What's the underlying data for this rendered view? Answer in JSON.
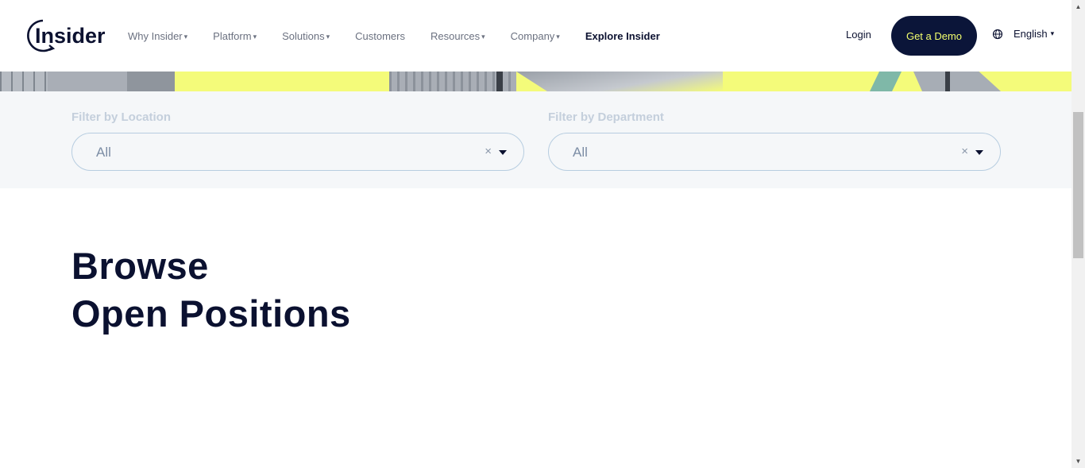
{
  "brand": {
    "logo_text": "Insider"
  },
  "nav": {
    "items": [
      {
        "label": "Why Insider",
        "has_dropdown": true
      },
      {
        "label": "Platform",
        "has_dropdown": true
      },
      {
        "label": "Solutions",
        "has_dropdown": true
      },
      {
        "label": "Customers",
        "has_dropdown": false
      },
      {
        "label": "Resources",
        "has_dropdown": true
      },
      {
        "label": "Company",
        "has_dropdown": true
      },
      {
        "label": "Explore Insider",
        "has_dropdown": false
      }
    ],
    "caret": "▾"
  },
  "header_actions": {
    "login_label": "Login",
    "demo_label": "Get a Demo",
    "language_label": "English",
    "language_caret": "▾"
  },
  "filters": {
    "location": {
      "label": "Filter by Location",
      "value": "All",
      "clear": "×"
    },
    "department": {
      "label": "Filter by Department",
      "value": "All",
      "clear": "×"
    }
  },
  "heading": {
    "line1": "Browse",
    "line2": "Open Positions"
  },
  "colors": {
    "navy": "#0b1539",
    "accent_yellow": "#f3ff6d",
    "filter_band_bg": "#f5f7f9",
    "select_border": "#b7cde0"
  },
  "icons": {
    "globe": "globe-icon",
    "chevron": "chevron-down-icon",
    "clear": "close-icon"
  }
}
